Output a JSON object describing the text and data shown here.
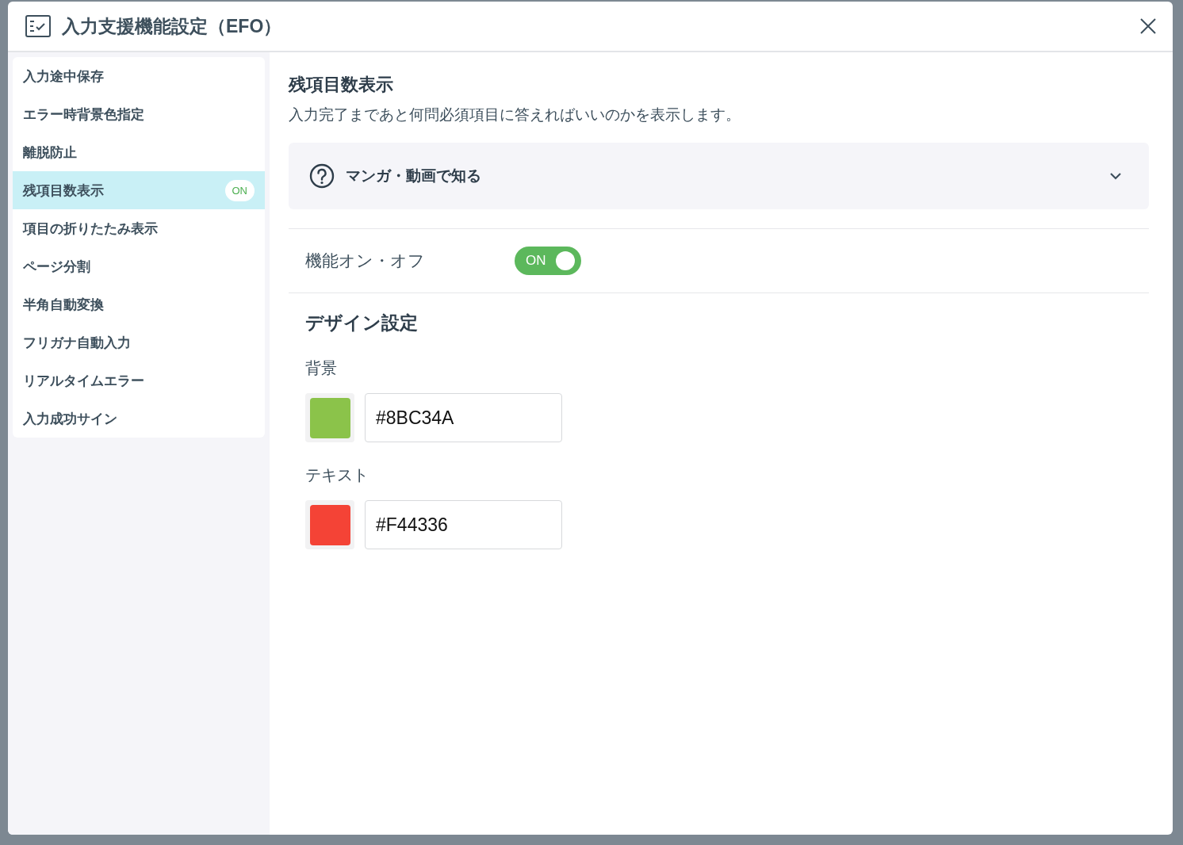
{
  "dialog": {
    "title": "入力支援機能設定（EFO）"
  },
  "sidebar": {
    "items": [
      {
        "label": "入力途中保存",
        "selected": false
      },
      {
        "label": "エラー時背景色指定",
        "selected": false
      },
      {
        "label": "離脱防止",
        "selected": false
      },
      {
        "label": "残項目数表示",
        "selected": true,
        "badge": "ON"
      },
      {
        "label": "項目の折りたたみ表示",
        "selected": false
      },
      {
        "label": "ページ分割",
        "selected": false
      },
      {
        "label": "半角自動変換",
        "selected": false
      },
      {
        "label": "フリガナ自動入力",
        "selected": false
      },
      {
        "label": "リアルタイムエラー",
        "selected": false
      },
      {
        "label": "入力成功サイン",
        "selected": false
      }
    ]
  },
  "content": {
    "heading": "残項目数表示",
    "description": "入力完了まであと何問必須項目に答えればいいのかを表示します。",
    "accordion": {
      "label": "マンガ・動画で知る",
      "expanded": false
    },
    "toggle": {
      "label": "機能オン・オフ",
      "value": "ON",
      "on": true
    },
    "design": {
      "heading": "デザイン設定",
      "fields": [
        {
          "label": "背景",
          "value": "#8BC34A",
          "color": "#8bc34a"
        },
        {
          "label": "テキスト",
          "value": "#F44336",
          "color": "#f44336"
        }
      ]
    }
  }
}
